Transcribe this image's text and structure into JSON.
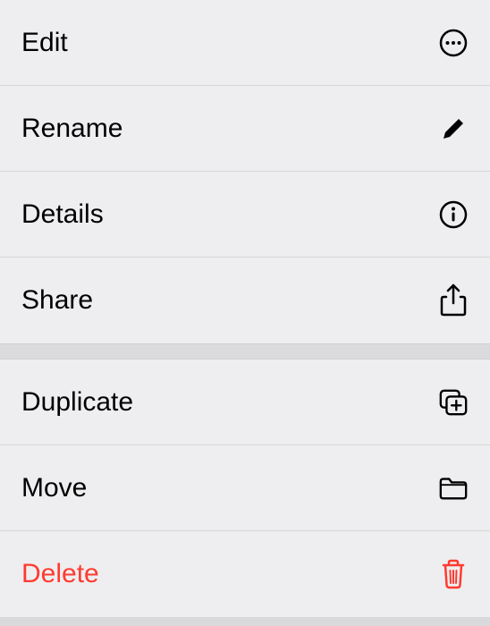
{
  "menu": {
    "section1": [
      {
        "label": "Edit",
        "icon": "more-icon"
      },
      {
        "label": "Rename",
        "icon": "pencil-icon"
      },
      {
        "label": "Details",
        "icon": "info-icon"
      },
      {
        "label": "Share",
        "icon": "share-icon"
      }
    ],
    "section2": [
      {
        "label": "Duplicate",
        "icon": "duplicate-icon"
      },
      {
        "label": "Move",
        "icon": "folder-icon"
      },
      {
        "label": "Delete",
        "icon": "trash-icon",
        "destructive": true
      }
    ]
  }
}
